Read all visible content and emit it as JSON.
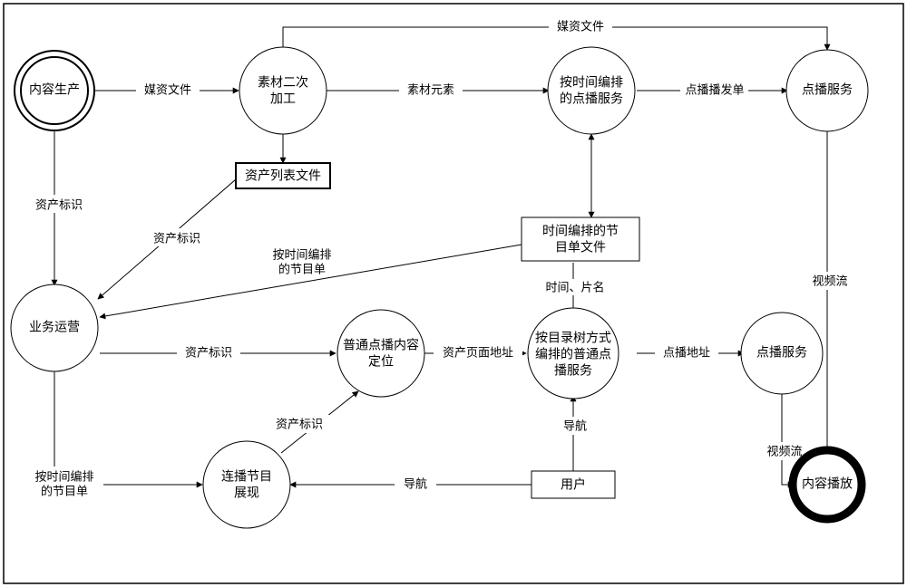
{
  "nodes": {
    "n_content_prod": {
      "label": "内容生产"
    },
    "n_material_proc": {
      "label1": "素材二次",
      "label2": "加工"
    },
    "n_time_vod": {
      "label1": "按时间编排",
      "label2": "的点播服务"
    },
    "n_vod_svc1": {
      "label": "点播服务"
    },
    "n_biz_ops": {
      "label": "业务运营"
    },
    "n_plain_vod_loc": {
      "label1": "普通点播内容",
      "label2": "定位"
    },
    "n_dir_tree_vod": {
      "label1": "按目录树方式",
      "label2": "编排的普通点",
      "label3": "播服务"
    },
    "n_vod_svc2": {
      "label": "点播服务"
    },
    "n_serial_show": {
      "label1": "连播节目",
      "label2": "展现"
    },
    "n_play": {
      "label": "内容播放"
    },
    "r_asset_list": {
      "label": "资产列表文件"
    },
    "r_time_sched_file": {
      "label1": "时间编排的节",
      "label2": "目单文件"
    },
    "r_user": {
      "label": "用户"
    }
  },
  "edges": {
    "e_media1": {
      "label": "媒资文件"
    },
    "e_media2": {
      "label": "媒资文件"
    },
    "e_mat_elem": {
      "label": "素材元素"
    },
    "e_vod_order": {
      "label": "点播播发单"
    },
    "e_asset_id1": {
      "label": "资产标识"
    },
    "e_asset_id2": {
      "label": "资产标识"
    },
    "e_asset_id3": {
      "label": "资产标识"
    },
    "e_asset_id4": {
      "label": "资产标识"
    },
    "e_time_sched": {
      "label1": "按时间编排",
      "label2": "的节目单"
    },
    "e_time_title": {
      "label": "时间、片名"
    },
    "e_asset_page": {
      "label": "资产页面地址"
    },
    "e_vod_addr": {
      "label": "点播地址"
    },
    "e_nav1": {
      "label": "导航"
    },
    "e_nav2": {
      "label": "导航"
    },
    "e_vstream1": {
      "label": "视频流"
    },
    "e_vstream2": {
      "label": "视频流"
    },
    "e_time_sched2": {
      "label1": "按时间编排",
      "label2": "的节目单"
    }
  }
}
